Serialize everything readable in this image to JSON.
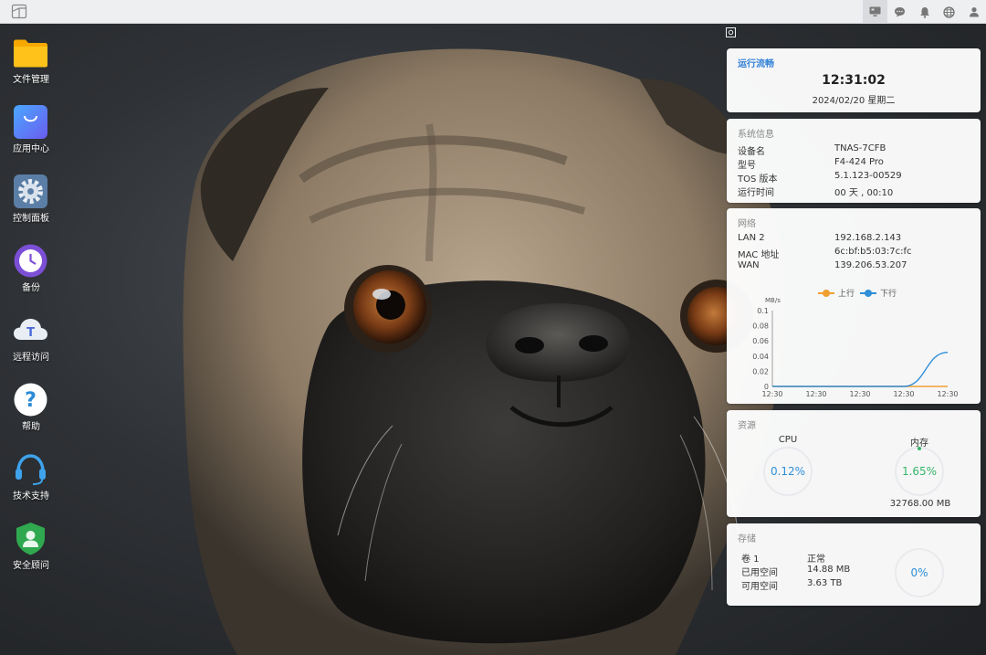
{
  "topbar": {
    "logo_icon": "window-icon",
    "tray_icons": [
      "desktop-icon",
      "chat-icon",
      "bell-icon",
      "globe-icon",
      "user-icon"
    ]
  },
  "desktop": {
    "apps": [
      {
        "label": "文件管理",
        "icon": "folder-icon"
      },
      {
        "label": "应用中心",
        "icon": "shopping-bag-icon"
      },
      {
        "label": "控制面板",
        "icon": "gear-icon"
      },
      {
        "label": "备份",
        "icon": "clock-icon"
      },
      {
        "label": "远程访问",
        "icon": "cloud-icon"
      },
      {
        "label": "帮助",
        "icon": "question-icon"
      },
      {
        "label": "技术支持",
        "icon": "headset-icon"
      },
      {
        "label": "安全顾问",
        "icon": "shield-icon"
      }
    ]
  },
  "widgets": {
    "clock": {
      "title": "运行流畅",
      "time": "12:31:02",
      "date": "2024/02/20 星期二"
    },
    "system": {
      "title": "系统信息",
      "rows": [
        {
          "k": "设备名",
          "v": "TNAS-7CFB"
        },
        {
          "k": "型号",
          "v": "F4-424 Pro"
        },
        {
          "k": "TOS 版本",
          "v": "5.1.123-00529"
        },
        {
          "k": "运行时间",
          "v": "00 天 , 00:10"
        }
      ]
    },
    "network": {
      "title": "网络",
      "rows": [
        {
          "k": "LAN 2",
          "v": "192.168.2.143"
        },
        {
          "k": "MAC 地址",
          "v": "6c:bf:b5:03:7c:fc"
        },
        {
          "k": "WAN",
          "v": "139.206.53.207"
        }
      ],
      "legend_up": "上行",
      "legend_down": "下行",
      "unit": "MB/s"
    },
    "resources": {
      "title": "资源",
      "cpu_label": "CPU",
      "cpu_value": "0.12%",
      "mem_label": "内存",
      "mem_value": "1.65%",
      "mem_total": "32768.00 MB"
    },
    "storage": {
      "title": "存储",
      "rows": [
        {
          "k": "卷 1",
          "v": "正常"
        },
        {
          "k": "已用空间",
          "v": "14.88 MB"
        },
        {
          "k": "可用空间",
          "v": "3.63 TB"
        }
      ],
      "usage": "0%"
    }
  },
  "colors": {
    "accent": "#2e7fd6",
    "up": "#f0a030",
    "down": "#2f8fd8",
    "cpu": "#2f8fd8",
    "mem": "#35b56a"
  },
  "chart_data": {
    "type": "line",
    "title": "",
    "ylabel": "MB/s",
    "x": [
      "12:30",
      "12:30",
      "12:30",
      "12:30",
      "12:30"
    ],
    "ylim": [
      0,
      0.1
    ],
    "yticks": [
      "0",
      "0.02",
      "0.04",
      "0.06",
      "0.08",
      "0.1"
    ],
    "series": [
      {
        "name": "上行",
        "color": "#f0a030",
        "values": [
          0,
          0,
          0,
          0,
          0
        ]
      },
      {
        "name": "下行",
        "color": "#2f8fd8",
        "values": [
          0,
          0,
          0,
          0,
          0.045
        ]
      }
    ],
    "legend": "top",
    "grid": false
  }
}
